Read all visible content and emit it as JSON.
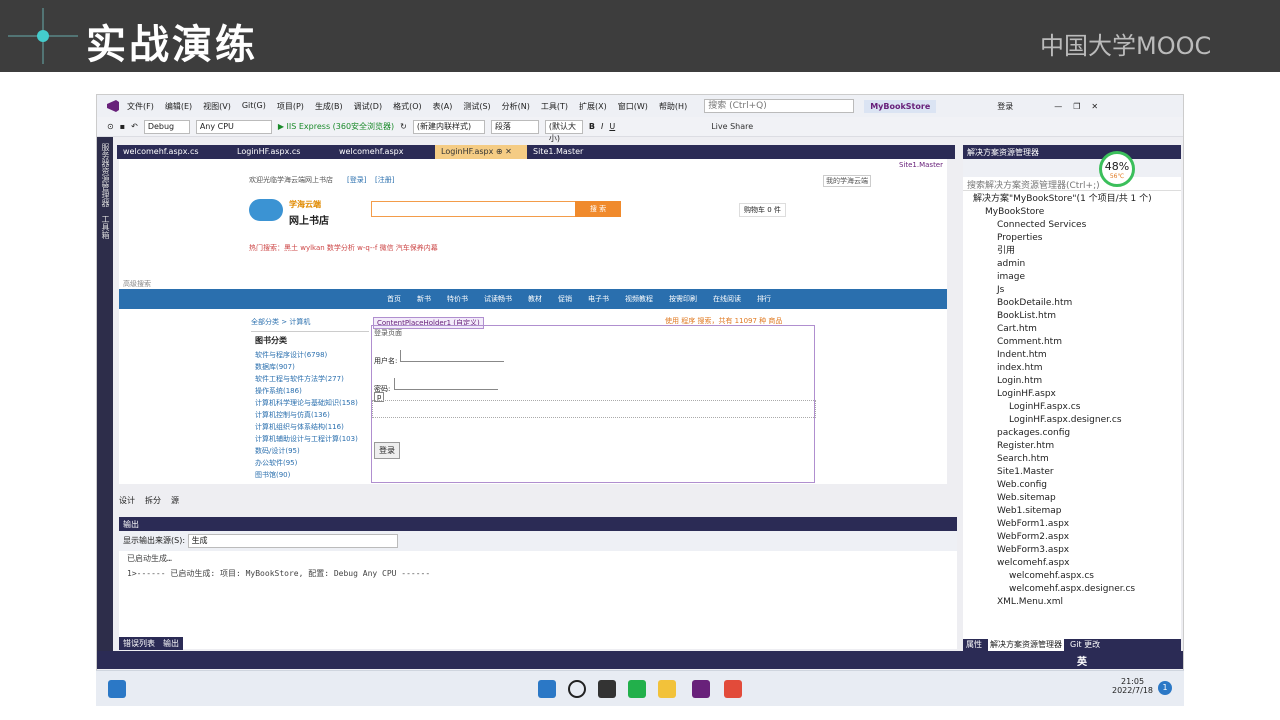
{
  "banner": {
    "title": "实战演练",
    "brand": "中国大学MOOC"
  },
  "menu": [
    "文件(F)",
    "编辑(E)",
    "视图(V)",
    "Git(G)",
    "项目(P)",
    "生成(B)",
    "调试(D)",
    "格式(O)",
    "表(A)",
    "测试(S)",
    "分析(N)",
    "工具(T)",
    "扩展(X)",
    "窗口(W)",
    "帮助(H)"
  ],
  "search_placeholder": "搜索 (Ctrl+Q)",
  "solution_name": "MyBookStore",
  "login": "登录",
  "toolbar": {
    "config": "Debug",
    "platform": "Any CPU",
    "run": "IIS Express (360安全浏览器)",
    "style": "(新建内联样式)",
    "para": "段落",
    "font": "(默认大小)",
    "live_share": "Live Share"
  },
  "tabs": [
    "welcomehf.aspx.cs",
    "LoginHF.aspx.cs",
    "welcomehf.aspx",
    "LoginHF.aspx",
    "Site1.Master"
  ],
  "master_label": "Site1.Master",
  "page": {
    "welcome": "欢迎光临学海云端网上书店",
    "login": "[登录]",
    "register": "[注册]",
    "mine": "我的学海云端",
    "logo1": "学海云端",
    "logo2": "网上书店",
    "search_btn": "搜 索",
    "cart": "购物车 0 件",
    "hot": "热门搜索：黑土  wylkan  数学分析  w-q--f  微信  汽车保养内幕",
    "adv": "高级搜索",
    "nav": [
      "首页",
      "新书",
      "特价书",
      "试读畅书",
      "教材",
      "促销",
      "电子书",
      "视频教程",
      "按需印刷",
      "在线阅读",
      "排行"
    ],
    "crumb": "全部分类 > 计算机",
    "placeholder": "ContentPlaceHolder1 (自定义)",
    "total": "使用 程序 搜索，共有 11097 种 商品",
    "cat_title": "图书分类",
    "cats": [
      "软件与程序设计(6798)",
      "数据库(907)",
      "软件工程与软件方法学(277)",
      "操作系统(186)",
      "计算机科学理论与基础知识(158)",
      "计算机控制与仿真(136)",
      "计算机组织与体系结构(116)",
      "计算机辅助设计与工程计算(103)",
      "数码/设计(95)",
      "办公软件(95)",
      "图书馆(90)"
    ],
    "login_page": "登录页面",
    "user": "用户名:",
    "pwd": "密码:",
    "p": "p",
    "login_btn": "登录"
  },
  "views": [
    "设计",
    "拆分",
    "源"
  ],
  "output": {
    "title": "输出",
    "source_label": "显示输出来源(S):",
    "source": "生成",
    "line1": "已启动生成…",
    "line2": "1>------ 已启动生成: 项目: MyBookStore, 配置: Debug Any CPU ------"
  },
  "bottom_tabs": [
    "错误列表",
    "输出"
  ],
  "left_strip": [
    "服务器资源管理器",
    "工具箱"
  ],
  "solution_explorer": {
    "title": "解决方案资源管理器",
    "search": "搜索解决方案资源管理器(Ctrl+;)",
    "gauge": "48%",
    "temp": "56℃",
    "items": [
      {
        "t": "解决方案\"MyBookStore\"(1 个项目/共 1 个)",
        "i": 0
      },
      {
        "t": "MyBookStore",
        "i": 1
      },
      {
        "t": "Connected Services",
        "i": 2
      },
      {
        "t": "Properties",
        "i": 2
      },
      {
        "t": "引用",
        "i": 2
      },
      {
        "t": "admin",
        "i": 2
      },
      {
        "t": "image",
        "i": 2
      },
      {
        "t": "Js",
        "i": 2
      },
      {
        "t": "BookDetaile.htm",
        "i": 2
      },
      {
        "t": "BookList.htm",
        "i": 2
      },
      {
        "t": "Cart.htm",
        "i": 2
      },
      {
        "t": "Comment.htm",
        "i": 2
      },
      {
        "t": "Indent.htm",
        "i": 2
      },
      {
        "t": "index.htm",
        "i": 2
      },
      {
        "t": "Login.htm",
        "i": 2
      },
      {
        "t": "LoginHF.aspx",
        "i": 2
      },
      {
        "t": "LoginHF.aspx.cs",
        "i": 3
      },
      {
        "t": "LoginHF.aspx.designer.cs",
        "i": 3
      },
      {
        "t": "packages.config",
        "i": 2
      },
      {
        "t": "Register.htm",
        "i": 2
      },
      {
        "t": "Search.htm",
        "i": 2
      },
      {
        "t": "Site1.Master",
        "i": 2
      },
      {
        "t": "Web.config",
        "i": 2
      },
      {
        "t": "Web.sitemap",
        "i": 2
      },
      {
        "t": "Web1.sitemap",
        "i": 2
      },
      {
        "t": "WebForm1.aspx",
        "i": 2
      },
      {
        "t": "WebForm2.aspx",
        "i": 2
      },
      {
        "t": "WebForm3.aspx",
        "i": 2
      },
      {
        "t": "welcomehf.aspx",
        "i": 2
      },
      {
        "t": "welcomehf.aspx.cs",
        "i": 3
      },
      {
        "t": "welcomehf.aspx.designer.cs",
        "i": 3
      },
      {
        "t": "XML.Menu.xml",
        "i": 2
      }
    ],
    "tabs": [
      "属性",
      "解决方案资源管理器",
      "Git 更改"
    ]
  },
  "tray": {
    "ime": "英",
    "time": "21:05",
    "date": "2022/7/18",
    "badge": "1"
  },
  "colors": {
    "accent": "#68217a",
    "navbar": "#2a6fae",
    "tab_active": "#f5cc84"
  }
}
